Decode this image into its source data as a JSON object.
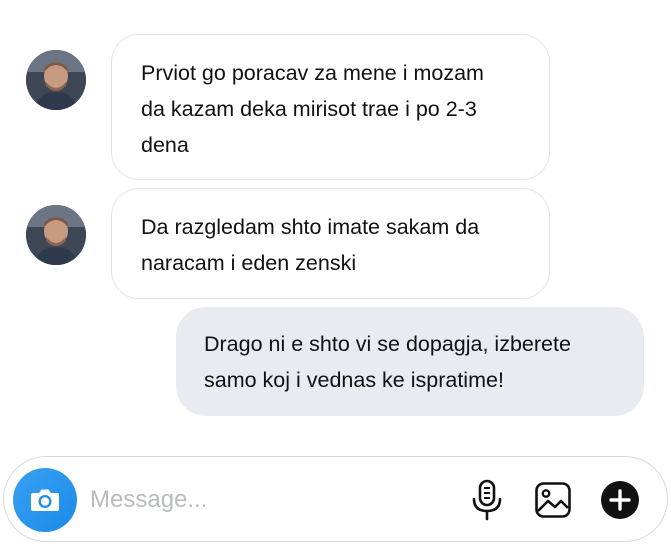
{
  "conversation": {
    "messages": [
      {
        "sender": "incoming",
        "avatar_icon": "user-avatar",
        "lines": [
          "Prviot go poracav za mene i mozam",
          "da kazam deka mirisot trae i po 2-3",
          "dena"
        ]
      },
      {
        "sender": "incoming",
        "avatar_icon": "user-avatar",
        "lines": [
          "Da razgledam shto imate sakam da",
          "naracam i eden zenski"
        ]
      },
      {
        "sender": "outgoing",
        "lines": [
          "Drago ni e shto vi se dopagja, izberete",
          "samo koj i vednas ke ispratime!"
        ]
      }
    ]
  },
  "composer": {
    "placeholder": "Message...",
    "value": "",
    "icons": [
      "camera-icon",
      "microphone-icon",
      "image-icon",
      "plus-icon"
    ]
  },
  "colors": {
    "accent": "#1a8be8",
    "outgoing_bubble": "#e8ecf0",
    "incoming_border": "#e2e4e8",
    "placeholder": "#b8bcc2"
  }
}
